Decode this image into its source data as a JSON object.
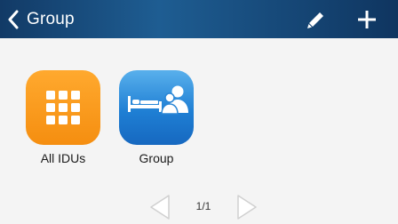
{
  "header": {
    "title": "Group",
    "icons": {
      "back": "chevron-left-icon",
      "edit": "pencil-icon",
      "add": "plus-icon"
    },
    "colors": {
      "bar_dark": "#123a66",
      "bar_light": "#1e5d92"
    }
  },
  "tiles": [
    {
      "label": "All IDUs",
      "icon": "grid-icon",
      "color": "#f7941d"
    },
    {
      "label": "Group",
      "icon": "bed-people-icon",
      "color": "#1f7fd4"
    }
  ],
  "pager": {
    "page_text": "1/1",
    "icons": {
      "prev": "triangle-left-icon",
      "next": "triangle-right-icon"
    }
  }
}
